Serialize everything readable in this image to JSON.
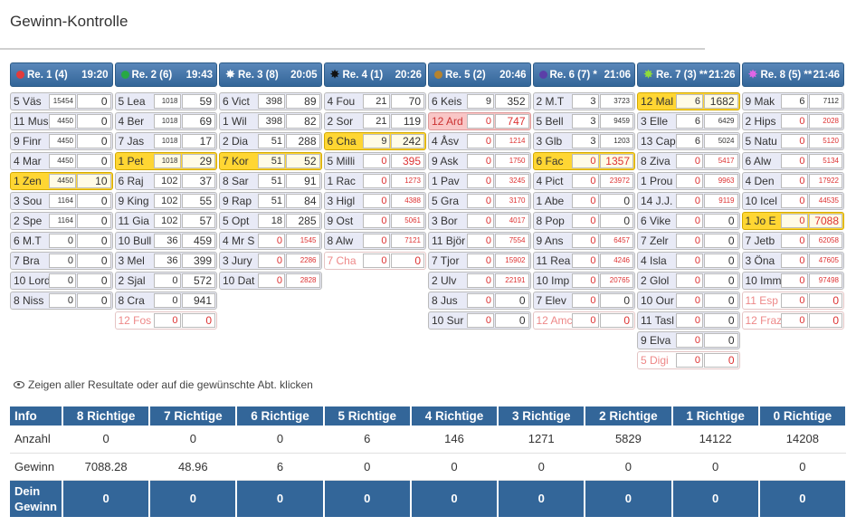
{
  "title": "Gewinn-Kontrolle",
  "note": "Zeigen aller Resultate oder auf die gewünschte Abt. klicken",
  "races": [
    {
      "label": "Re. 1 (4)",
      "time": "19:20",
      "icon": "dot",
      "color": "#e33b3b",
      "rows": [
        {
          "n": "5 Väs",
          "a": "15454",
          "b": "0"
        },
        {
          "n": "11 Mus",
          "a": "4450",
          "b": "0"
        },
        {
          "n": "9 Finr",
          "a": "4450",
          "b": "0"
        },
        {
          "n": "4 Mar",
          "a": "4450",
          "b": "0"
        },
        {
          "n": "1 Zen",
          "a": "4450",
          "b": "10",
          "s": "win"
        },
        {
          "n": "3 Sou",
          "a": "1164",
          "b": "0"
        },
        {
          "n": "2 Spe",
          "a": "1164",
          "b": "0"
        },
        {
          "n": "6 M.T",
          "a": "0",
          "b": "0"
        },
        {
          "n": "7 Bra",
          "a": "0",
          "b": "0"
        },
        {
          "n": "10 Lord",
          "a": "0",
          "b": "0"
        },
        {
          "n": "8 Niss",
          "a": "0",
          "b": "0"
        }
      ]
    },
    {
      "label": "Re. 2 (6)",
      "time": "19:43",
      "icon": "dot",
      "color": "#27a844",
      "rows": [
        {
          "n": "5 Lea",
          "a": "1018",
          "b": "59"
        },
        {
          "n": "4 Ber",
          "a": "1018",
          "b": "69"
        },
        {
          "n": "7 Jas",
          "a": "1018",
          "b": "17"
        },
        {
          "n": "1 Pet",
          "a": "1018",
          "b": "29",
          "s": "win"
        },
        {
          "n": "6 Raj",
          "a": "102",
          "b": "37"
        },
        {
          "n": "9 King",
          "a": "102",
          "b": "55"
        },
        {
          "n": "11 Gia",
          "a": "102",
          "b": "57"
        },
        {
          "n": "10 Bull",
          "a": "36",
          "b": "459"
        },
        {
          "n": "3 Mel",
          "a": "36",
          "b": "399"
        },
        {
          "n": "2 Sjal",
          "a": "0",
          "b": "572"
        },
        {
          "n": "8 Cra",
          "a": "0",
          "b": "941"
        },
        {
          "n": "12 Fos",
          "a": "0",
          "b": "0",
          "s": "out"
        }
      ]
    },
    {
      "label": "Re. 3 (8)",
      "time": "20:05",
      "icon": "star",
      "color": "#ffffff",
      "rows": [
        {
          "n": "6 Vict",
          "a": "398",
          "b": "89"
        },
        {
          "n": "1 Wil",
          "a": "398",
          "b": "82"
        },
        {
          "n": "2 Dia",
          "a": "51",
          "b": "288"
        },
        {
          "n": "7 Kor",
          "a": "51",
          "b": "52",
          "s": "win"
        },
        {
          "n": "8 Sar",
          "a": "51",
          "b": "91"
        },
        {
          "n": "9 Rap",
          "a": "51",
          "b": "84"
        },
        {
          "n": "5 Opt",
          "a": "18",
          "b": "285"
        },
        {
          "n": "4 Mr S",
          "a": "0",
          "b": "1545"
        },
        {
          "n": "3 Jury",
          "a": "0",
          "b": "2286"
        },
        {
          "n": "10 Dat",
          "a": "0",
          "b": "2828"
        }
      ]
    },
    {
      "label": "Re. 4 (1)",
      "time": "20:26",
      "icon": "star",
      "color": "#111111",
      "rows": [
        {
          "n": "4 Fou",
          "a": "21",
          "b": "70"
        },
        {
          "n": "2 Sor",
          "a": "21",
          "b": "119"
        },
        {
          "n": "6 Cha",
          "a": "9",
          "b": "242",
          "s": "win"
        },
        {
          "n": "5 Milli",
          "a": "0",
          "b": "395"
        },
        {
          "n": "1 Rac",
          "a": "0",
          "b": "1273"
        },
        {
          "n": "3 Higl",
          "a": "0",
          "b": "4388"
        },
        {
          "n": "9 Ost",
          "a": "0",
          "b": "5061"
        },
        {
          "n": "8 Alw",
          "a": "0",
          "b": "7121"
        },
        {
          "n": "7 Cha",
          "a": "0",
          "b": "0",
          "s": "out"
        }
      ]
    },
    {
      "label": "Re. 5 (2)",
      "time": "20:46",
      "icon": "dot",
      "color": "#b5832e",
      "rows": [
        {
          "n": "6 Keis",
          "a": "9",
          "b": "352"
        },
        {
          "n": "12 Ard",
          "a": "0",
          "b": "747",
          "s": "pink"
        },
        {
          "n": "4 Åsv",
          "a": "0",
          "b": "1214"
        },
        {
          "n": "9 Ask",
          "a": "0",
          "b": "1750"
        },
        {
          "n": "1 Pav",
          "a": "0",
          "b": "3245"
        },
        {
          "n": "5 Gra",
          "a": "0",
          "b": "3170"
        },
        {
          "n": "3 Bor",
          "a": "0",
          "b": "4017"
        },
        {
          "n": "11 Björ",
          "a": "0",
          "b": "7554"
        },
        {
          "n": "7 Tjor",
          "a": "0",
          "b": "15902"
        },
        {
          "n": "2 Ulv",
          "a": "0",
          "b": "22191"
        },
        {
          "n": "8 Jus",
          "a": "0",
          "b": "0"
        },
        {
          "n": "10 Sur",
          "a": "0",
          "b": "0"
        }
      ]
    },
    {
      "label": "Re. 6 (7) *",
      "time": "21:06",
      "icon": "dot",
      "color": "#5b3fa8",
      "rows": [
        {
          "n": "2 M.T",
          "a": "3",
          "b": "3723"
        },
        {
          "n": "5 Bell",
          "a": "3",
          "b": "9459"
        },
        {
          "n": "3 Glb",
          "a": "3",
          "b": "1203"
        },
        {
          "n": "6 Fac",
          "a": "0",
          "b": "1357",
          "s": "win"
        },
        {
          "n": "4 Pict",
          "a": "0",
          "b": "23972"
        },
        {
          "n": "1 Abe",
          "a": "0",
          "b": "0"
        },
        {
          "n": "8 Pop",
          "a": "0",
          "b": "0"
        },
        {
          "n": "9 Ans",
          "a": "0",
          "b": "6457"
        },
        {
          "n": "11 Rea",
          "a": "0",
          "b": "4246"
        },
        {
          "n": "10 Imp",
          "a": "0",
          "b": "20765"
        },
        {
          "n": "7 Elev",
          "a": "0",
          "b": "0"
        },
        {
          "n": "12 Amc",
          "a": "0",
          "b": "0",
          "s": "out"
        }
      ]
    },
    {
      "label": "Re. 7 (3) **",
      "time": "21:26",
      "icon": "star",
      "color": "#8fdc3a",
      "rows": [
        {
          "n": "12 Mal",
          "a": "6",
          "b": "1682",
          "s": "win"
        },
        {
          "n": "3 Elle",
          "a": "6",
          "b": "6429"
        },
        {
          "n": "13 Cap",
          "a": "6",
          "b": "5024"
        },
        {
          "n": "8 Ziva",
          "a": "0",
          "b": "5417"
        },
        {
          "n": "1 Prou",
          "a": "0",
          "b": "9963"
        },
        {
          "n": "14 J.J.",
          "a": "0",
          "b": "9119"
        },
        {
          "n": "6 Vike",
          "a": "0",
          "b": "0"
        },
        {
          "n": "7 Zelr",
          "a": "0",
          "b": "0"
        },
        {
          "n": "4 Isla",
          "a": "0",
          "b": "0"
        },
        {
          "n": "2 Glol",
          "a": "0",
          "b": "0"
        },
        {
          "n": "10 Our",
          "a": "0",
          "b": "0"
        },
        {
          "n": "11 Tasl",
          "a": "0",
          "b": "0"
        },
        {
          "n": "9 Elva",
          "a": "0",
          "b": "0"
        },
        {
          "n": "5 Digi",
          "a": "0",
          "b": "0",
          "s": "out"
        }
      ]
    },
    {
      "label": "Re. 8 (5) **",
      "time": "21:46",
      "icon": "star",
      "color": "#e065e6",
      "rows": [
        {
          "n": "9 Mak",
          "a": "6",
          "b": "7112"
        },
        {
          "n": "2 Hips",
          "a": "0",
          "b": "2028"
        },
        {
          "n": "5 Natu",
          "a": "0",
          "b": "5120"
        },
        {
          "n": "6 Alw",
          "a": "0",
          "b": "5134"
        },
        {
          "n": "4 Den",
          "a": "0",
          "b": "17922"
        },
        {
          "n": "10 Icel",
          "a": "0",
          "b": "44535"
        },
        {
          "n": "1 Jo E",
          "a": "0",
          "b": "7088",
          "s": "win"
        },
        {
          "n": "7 Jetb",
          "a": "0",
          "b": "62058"
        },
        {
          "n": "3 Öna",
          "a": "0",
          "b": "47605"
        },
        {
          "n": "10 Imm",
          "a": "0",
          "b": "97498"
        },
        {
          "n": "11 Esp",
          "a": "0",
          "b": "0",
          "s": "out"
        },
        {
          "n": "12 Fraz",
          "a": "0",
          "b": "0",
          "s": "out"
        }
      ]
    }
  ],
  "table": {
    "headers": [
      "Info",
      "8 Richtige",
      "7 Richtige",
      "6 Richtige",
      "5 Richtige",
      "4 Richtige",
      "3 Richtige",
      "2 Richtige",
      "1 Richtige",
      "0 Richtige"
    ],
    "rows": [
      [
        "Anzahl",
        "0",
        "0",
        "0",
        "6",
        "146",
        "1271",
        "5829",
        "14122",
        "14208"
      ],
      [
        "Gewinn",
        "7088.28",
        "48.96",
        "6",
        "0",
        "0",
        "0",
        "0",
        "0",
        "0"
      ]
    ],
    "mine_label": "Dein Gewinn",
    "mine": [
      "0",
      "0",
      "0",
      "0",
      "0",
      "0",
      "0",
      "0",
      "0"
    ]
  }
}
